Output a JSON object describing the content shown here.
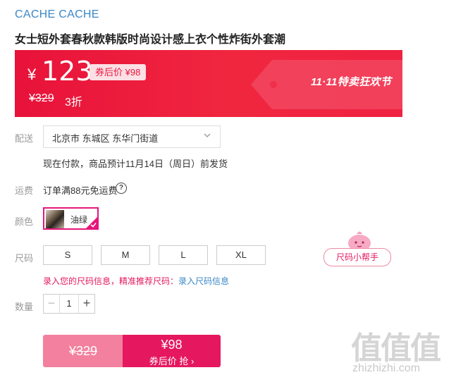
{
  "brand": "CACHE CACHE",
  "product_title": "女士短外套春秋款韩版时尚设计感上衣个性炸街外套潮",
  "price": {
    "currency": "¥",
    "current": "123",
    "coupon_label": "券后价 ¥98",
    "original": "¥329",
    "discount": "3折",
    "festival": "11·11特卖狂欢节"
  },
  "delivery": {
    "label": "配送",
    "address": "北京市 东城区 东华门街道",
    "note": "现在付款，商品预计11月14日（周日）前发货"
  },
  "shipping": {
    "label": "运费",
    "text": "订单满88元免运费",
    "icon": "?"
  },
  "color": {
    "label": "颜色",
    "options": [
      {
        "name": "油绿",
        "selected": true
      }
    ]
  },
  "size": {
    "label": "尺码",
    "options": [
      "S",
      "M",
      "L",
      "XL"
    ],
    "helper": "尺码小帮手",
    "tip": "录入您的尺码信息，精准推荐尺码：",
    "tip_link": "录入尺码信息"
  },
  "quantity": {
    "label": "数量",
    "value": "1",
    "minus": "−",
    "plus": "+"
  },
  "buy": {
    "original": "¥329",
    "coupon_price": "¥98",
    "coupon_action": "券后价 抢 ›"
  },
  "watermark": {
    "logo_text": "值值值",
    "site": "zhizhizhi.com"
  },
  "colors": {
    "accent_red": "#e8123a",
    "pink": "#e5175f",
    "link_blue": "#3a87c8"
  }
}
